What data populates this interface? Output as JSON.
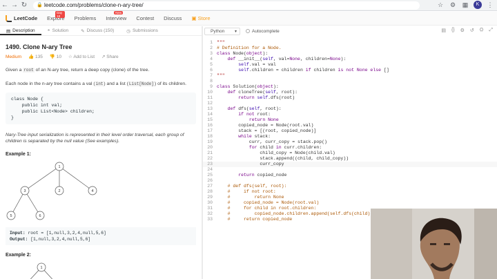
{
  "browser": {
    "url": "leetcode.com/problems/clone-n-ary-tree/",
    "avatar_letter": "K"
  },
  "site_nav": {
    "logo": "LeetCode",
    "links": [
      {
        "label": "Explore",
        "badge": "Day 18"
      },
      {
        "label": "Problems",
        "badge": ""
      },
      {
        "label": "Interview",
        "badge": "New"
      },
      {
        "label": "Contest",
        "badge": ""
      },
      {
        "label": "Discuss",
        "badge": ""
      },
      {
        "label": "Store",
        "badge": ""
      }
    ]
  },
  "tabs": [
    "Description",
    "Solution",
    "Discuss (150)",
    "Submissions"
  ],
  "problem": {
    "title": "1490. Clone N-ary Tree",
    "difficulty": "Medium",
    "likes": "135",
    "dislikes": "10",
    "add_to_list": "Add to List",
    "share": "Share",
    "desc1_a": "Given a ",
    "desc1_code": "root",
    "desc1_b": " of an N-ary tree, return a deep copy (clone) of the tree.",
    "desc2_a": "Each node in the n-ary tree contains a val (",
    "desc2_code1": "int",
    "desc2_b": ") and a list (",
    "desc2_code2": "List[Node]",
    "desc2_c": ") of its children.",
    "class_code": "class Node {\n    public int val;\n    public List<Node> children;\n}",
    "serialization_note": "Nary-Tree input serialization is represented in their level order traversal, each group of children is separated by the null value (See examples).",
    "example1_title": "Example 1:",
    "example1_input_label": "Input:",
    "example1_input": "root = [1,null,3,2,4,null,5,6]",
    "example1_output_label": "Output:",
    "example1_output": "[1,null,3,2,4,null,5,6]",
    "example2_title": "Example 2:"
  },
  "tree_example1": {
    "nodes": [
      "1",
      "3",
      "2",
      "4",
      "5",
      "6"
    ]
  },
  "tree_example2": {
    "nodes": [
      "1"
    ]
  },
  "editor": {
    "language": "Python",
    "autocomplete": "Autocomplete",
    "lines": [
      {
        "n": "1",
        "text": "\"\"\""
      },
      {
        "n": "2",
        "text": "# Definition for a Node."
      },
      {
        "n": "3",
        "text": "class Node(object):"
      },
      {
        "n": "4",
        "text": "    def __init__(self, val=None, children=None):"
      },
      {
        "n": "5",
        "text": "        self.val = val"
      },
      {
        "n": "6",
        "text": "        self.children = children if children is not None else []"
      },
      {
        "n": "7",
        "text": "\"\"\""
      },
      {
        "n": "8",
        "text": ""
      },
      {
        "n": "9",
        "text": "class Solution(object):"
      },
      {
        "n": "10",
        "text": "    def cloneTree(self, root):"
      },
      {
        "n": "11",
        "text": "        return self.dfs(root)"
      },
      {
        "n": "12",
        "text": ""
      },
      {
        "n": "13",
        "text": "    def dfs(self, root):"
      },
      {
        "n": "14",
        "text": "        if not root:"
      },
      {
        "n": "15",
        "text": "            return None"
      },
      {
        "n": "16",
        "text": "        copied_node = Node(root.val)"
      },
      {
        "n": "17",
        "text": "        stack = [(root, copied_node)]"
      },
      {
        "n": "18",
        "text": "        while stack:"
      },
      {
        "n": "19",
        "text": "            curr, curr_copy = stack.pop()"
      },
      {
        "n": "20",
        "text": "            for child in curr.children:"
      },
      {
        "n": "21",
        "text": "                child_copy = Node(child.val)"
      },
      {
        "n": "22",
        "text": "                stack.append((child, child_copy))"
      },
      {
        "n": "23",
        "text": "                curr_copy"
      },
      {
        "n": "24",
        "text": ""
      },
      {
        "n": "25",
        "text": "        return copied_node"
      },
      {
        "n": "26",
        "text": ""
      },
      {
        "n": "27",
        "text": "    # def dfs(self, root):"
      },
      {
        "n": "28",
        "text": "    #     if not root:"
      },
      {
        "n": "29",
        "text": "    #         return None"
      },
      {
        "n": "30",
        "text": "    #     copied_node = Node(root.val)"
      },
      {
        "n": "31",
        "text": "    #     for child in root.children:"
      },
      {
        "n": "32",
        "text": "    #         copied_node.children.append(self.dfs(child))"
      },
      {
        "n": "33",
        "text": "    #     return copied_node"
      }
    ]
  }
}
